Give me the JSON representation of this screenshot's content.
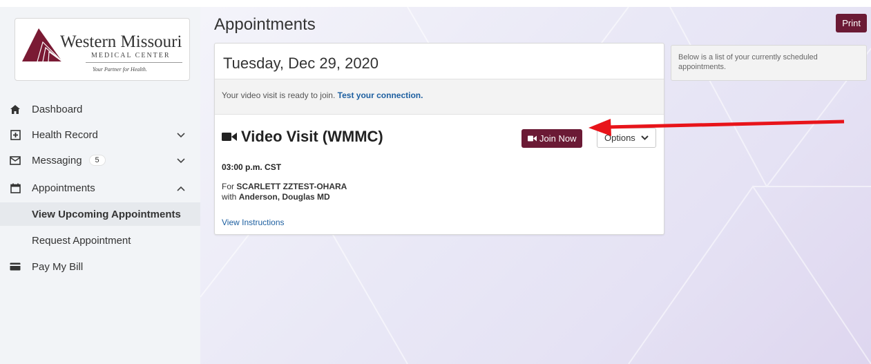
{
  "logo": {
    "title": "Western Missouri",
    "subtitle": "MEDICAL CENTER",
    "tagline": "Your Partner for Health."
  },
  "nav": {
    "items": [
      {
        "label": "Dashboard",
        "icon": "home-icon"
      },
      {
        "label": "Health Record",
        "icon": "health-record-icon",
        "chevron": "down"
      },
      {
        "label": "Messaging",
        "icon": "envelope-icon",
        "badge": "5",
        "chevron": "down"
      },
      {
        "label": "Appointments",
        "icon": "calendar-icon",
        "chevron": "up"
      },
      {
        "label": "Pay My Bill",
        "icon": "credit-card-icon"
      }
    ],
    "sub_items": [
      {
        "label": "View Upcoming Appointments",
        "active": true
      },
      {
        "label": "Request Appointment",
        "active": false
      }
    ]
  },
  "page": {
    "title": "Appointments",
    "print_label": "Print"
  },
  "appointment": {
    "date": "Tuesday, Dec 29, 2020",
    "notice_text": "Your video visit is ready to join. ",
    "notice_link": "Test your connection.",
    "visit_title": "Video Visit (WMMC)",
    "join_label": "Join Now",
    "options_label": "Options",
    "time": "03:00 p.m. CST",
    "for_prefix": "For ",
    "patient": "SCARLETT ZZTEST-OHARA",
    "with_prefix": "with ",
    "provider": "Anderson, Douglas MD",
    "instructions_link": "View Instructions"
  },
  "side_note": "Below is a list of your currently scheduled appointments.",
  "colors": {
    "brand": "#6b1a35",
    "link": "#1d5fa0",
    "arrow": "#e8141a"
  }
}
